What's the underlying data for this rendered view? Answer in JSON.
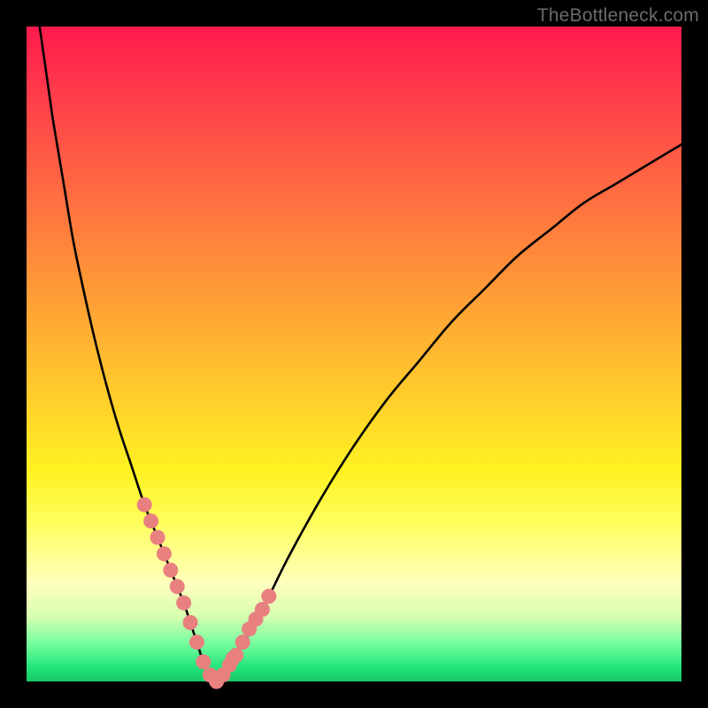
{
  "watermark": "TheBottleneck.com",
  "chart_data": {
    "type": "line",
    "title": "",
    "xlabel": "",
    "ylabel": "",
    "xlim": [
      0,
      100
    ],
    "ylim": [
      0,
      100
    ],
    "grid": false,
    "legend": false,
    "background_gradient": {
      "direction": "top-to-bottom",
      "stops": [
        {
          "pos": 0.0,
          "color": "#ff1a4d"
        },
        {
          "pos": 0.5,
          "color": "#ffb930"
        },
        {
          "pos": 0.76,
          "color": "#ffff60"
        },
        {
          "pos": 1.0,
          "color": "#18c768"
        }
      ]
    },
    "series": [
      {
        "name": "bottleneck-curve",
        "color": "#000000",
        "type": "line",
        "x": [
          2,
          3,
          4,
          5,
          6,
          7,
          8,
          10,
          12,
          14,
          16,
          18,
          20,
          22,
          24,
          25,
          26,
          27,
          28,
          29,
          30,
          32,
          36,
          40,
          45,
          50,
          55,
          60,
          65,
          70,
          75,
          80,
          85,
          90,
          95,
          100
        ],
        "values": [
          100,
          93,
          86,
          80,
          74,
          68,
          63,
          54,
          46,
          39,
          33,
          27,
          22,
          17,
          12,
          9,
          6,
          3,
          1,
          0,
          1,
          4,
          11,
          19,
          28,
          36,
          43,
          49,
          55,
          60,
          65,
          69,
          73,
          76,
          79,
          82
        ]
      },
      {
        "name": "curve-markers",
        "color": "#e98080",
        "type": "scatter",
        "x": [
          18,
          19,
          20,
          21,
          22,
          23,
          24,
          25,
          26,
          27,
          28,
          29,
          30,
          31,
          31.5,
          32,
          33,
          34,
          35,
          36,
          37
        ],
        "values": [
          27,
          24.5,
          22,
          19.5,
          17,
          14.5,
          12,
          9,
          6,
          3,
          1,
          0,
          1,
          2.5,
          3.5,
          4,
          6,
          8,
          9.5,
          11,
          13
        ]
      }
    ]
  }
}
